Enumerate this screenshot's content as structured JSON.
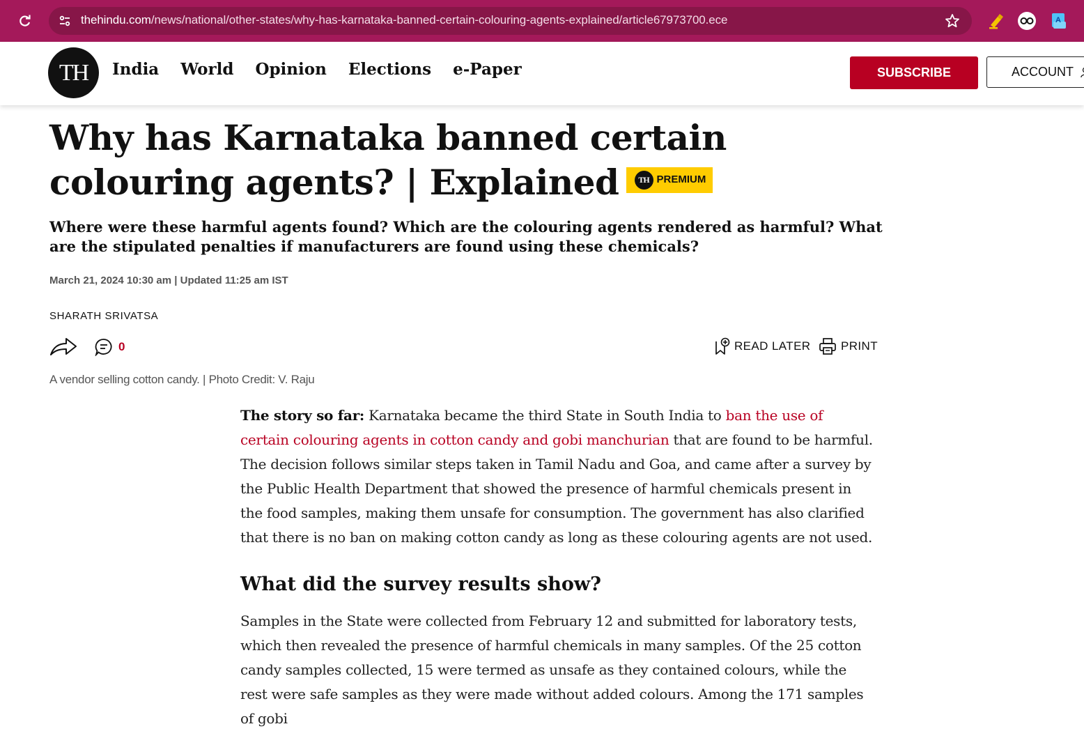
{
  "browser": {
    "url_domain": "thehindu.com",
    "url_path": "/news/national/other-states/why-has-karnataka-banned-certain-colouring-agents-explained/article67973700.ece"
  },
  "header": {
    "logo_text": "TH",
    "nav": [
      "India",
      "World",
      "Opinion",
      "Elections",
      "e-Paper"
    ],
    "subscribe_label": "SUBSCRIBE",
    "account_label": "ACCOUNT"
  },
  "article": {
    "headline": "Why has Karnataka banned certain colouring agents? | Explained",
    "premium_logo": "TH",
    "premium_label": "PREMIUM",
    "subheadline": "Where were these harmful agents found? Which are the colouring agents rendered as harmful? What are the stipulated penalties if manufacturers are found using these chemicals?",
    "dateline": "March 21, 2024 10:30 am | Updated 11:25 am IST",
    "author": "SHARATH SRIVATSA",
    "comment_count": "0",
    "read_later_label": "READ LATER",
    "print_label": "PRINT",
    "caption": "A vendor selling cotton candy. | Photo Credit: V. Raju",
    "para1": {
      "lead_in": "The story so far:",
      "text_before_link": " Karnataka became the third State in South India to ",
      "link_text": "ban the use of certain colouring agents in cotton candy and gobi manchurian",
      "text_after_link": " that are found to be harmful. The decision follows similar steps taken in Tamil Nadu and Goa, and came after a survey by the Public Health Department that showed the presence of harmful chemicals present in the food samples, making them unsafe for consumption. The government has also clarified that there is no ban on making cotton candy as long as these colouring agents are not used."
    },
    "section_heading": "What did the survey results show?",
    "para2": "Samples in the State were collected from February 12 and submitted for laboratory tests, which then revealed the presence of harmful chemicals in many samples. Of the 25 cotton candy samples collected, 15 were termed as unsafe as they contained colours, while the rest were safe samples as they were made without added colours. Among the 171 samples of gobi"
  },
  "colors": {
    "browser_bar": "#a4195a",
    "brand_red": "#b80022",
    "premium_yellow": "#ffcc00"
  }
}
